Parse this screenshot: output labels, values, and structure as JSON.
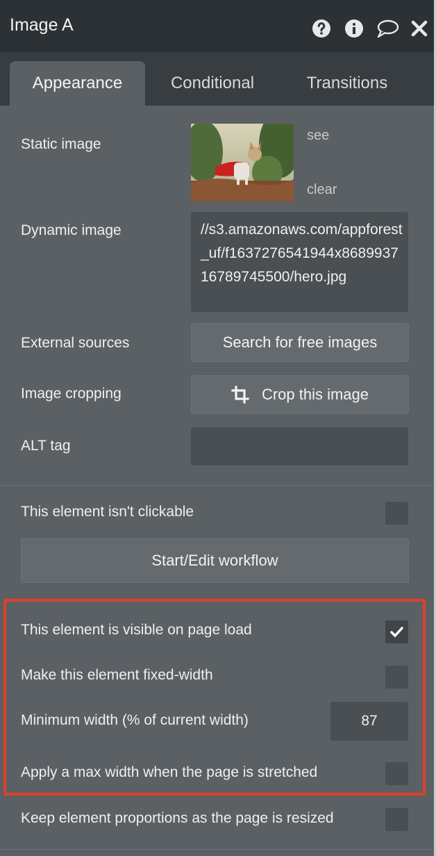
{
  "header": {
    "title": "Image A",
    "icons": [
      "help-circle-icon",
      "info-circle-icon",
      "comment-icon",
      "close-icon"
    ]
  },
  "tabs": [
    {
      "label": "Appearance",
      "active": true
    },
    {
      "label": "Conditional",
      "active": false
    },
    {
      "label": "Transitions",
      "active": false
    }
  ],
  "static_image": {
    "label": "Static image",
    "see_link": "see",
    "clear_link": "clear"
  },
  "dynamic_image": {
    "label": "Dynamic image",
    "value": "//s3.amazonaws.com/appforest_uf/f1637276541944x868993716789745500/hero.jpg"
  },
  "external_sources": {
    "label": "External sources",
    "button": "Search for free images"
  },
  "image_cropping": {
    "label": "Image cropping",
    "button": "Crop this image",
    "icon": "crop-icon"
  },
  "alt_tag": {
    "label": "ALT tag",
    "value": ""
  },
  "clickable": {
    "label": "This element isn't clickable",
    "checked": false
  },
  "workflow": {
    "button": "Start/Edit workflow"
  },
  "layout": {
    "visible_on_load": {
      "label": "This element is visible on page load",
      "checked": true
    },
    "fixed_width": {
      "label": "Make this element fixed-width",
      "checked": false
    },
    "min_width": {
      "label": "Minimum width (% of current width)",
      "value": "87"
    },
    "max_width": {
      "label": "Apply a max width when the page is stretched",
      "checked": false
    },
    "keep_proportions": {
      "label": "Keep element proportions as the page is resized",
      "checked": false
    }
  },
  "colors": {
    "panel_bg": "#5b6064",
    "header_bg": "#2c3135",
    "highlight": "#e0402a"
  }
}
